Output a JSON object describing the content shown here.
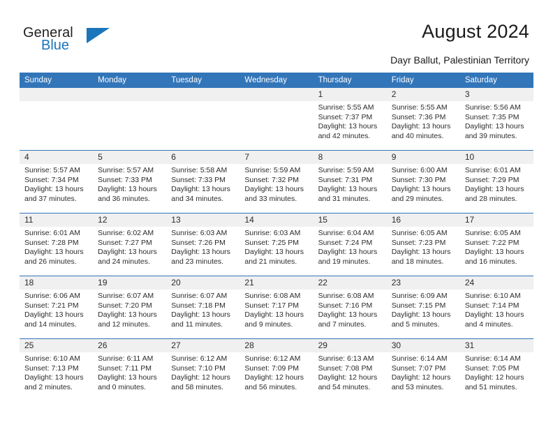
{
  "logo": {
    "text_dark": "General",
    "text_blue": "Blue",
    "accent_color": "#1b75bb",
    "triangle_icon": "logo-triangle-icon"
  },
  "header": {
    "title": "August 2024",
    "subtitle": "Dayr Ballut, Palestinian Territory"
  },
  "calendar": {
    "header_bg": "#3275b9",
    "daynum_bg": "#f0f0f0",
    "weekday_headers": [
      "Sunday",
      "Monday",
      "Tuesday",
      "Wednesday",
      "Thursday",
      "Friday",
      "Saturday"
    ],
    "weeks": [
      [
        {
          "day": "",
          "empty": true
        },
        {
          "day": "",
          "empty": true
        },
        {
          "day": "",
          "empty": true
        },
        {
          "day": "",
          "empty": true
        },
        {
          "day": "1",
          "sunrise": "Sunrise: 5:55 AM",
          "sunset": "Sunset: 7:37 PM",
          "daylight_line1": "Daylight: 13 hours",
          "daylight_line2": "and 42 minutes."
        },
        {
          "day": "2",
          "sunrise": "Sunrise: 5:55 AM",
          "sunset": "Sunset: 7:36 PM",
          "daylight_line1": "Daylight: 13 hours",
          "daylight_line2": "and 40 minutes."
        },
        {
          "day": "3",
          "sunrise": "Sunrise: 5:56 AM",
          "sunset": "Sunset: 7:35 PM",
          "daylight_line1": "Daylight: 13 hours",
          "daylight_line2": "and 39 minutes."
        }
      ],
      [
        {
          "day": "4",
          "sunrise": "Sunrise: 5:57 AM",
          "sunset": "Sunset: 7:34 PM",
          "daylight_line1": "Daylight: 13 hours",
          "daylight_line2": "and 37 minutes."
        },
        {
          "day": "5",
          "sunrise": "Sunrise: 5:57 AM",
          "sunset": "Sunset: 7:33 PM",
          "daylight_line1": "Daylight: 13 hours",
          "daylight_line2": "and 36 minutes."
        },
        {
          "day": "6",
          "sunrise": "Sunrise: 5:58 AM",
          "sunset": "Sunset: 7:33 PM",
          "daylight_line1": "Daylight: 13 hours",
          "daylight_line2": "and 34 minutes."
        },
        {
          "day": "7",
          "sunrise": "Sunrise: 5:59 AM",
          "sunset": "Sunset: 7:32 PM",
          "daylight_line1": "Daylight: 13 hours",
          "daylight_line2": "and 33 minutes."
        },
        {
          "day": "8",
          "sunrise": "Sunrise: 5:59 AM",
          "sunset": "Sunset: 7:31 PM",
          "daylight_line1": "Daylight: 13 hours",
          "daylight_line2": "and 31 minutes."
        },
        {
          "day": "9",
          "sunrise": "Sunrise: 6:00 AM",
          "sunset": "Sunset: 7:30 PM",
          "daylight_line1": "Daylight: 13 hours",
          "daylight_line2": "and 29 minutes."
        },
        {
          "day": "10",
          "sunrise": "Sunrise: 6:01 AM",
          "sunset": "Sunset: 7:29 PM",
          "daylight_line1": "Daylight: 13 hours",
          "daylight_line2": "and 28 minutes."
        }
      ],
      [
        {
          "day": "11",
          "sunrise": "Sunrise: 6:01 AM",
          "sunset": "Sunset: 7:28 PM",
          "daylight_line1": "Daylight: 13 hours",
          "daylight_line2": "and 26 minutes."
        },
        {
          "day": "12",
          "sunrise": "Sunrise: 6:02 AM",
          "sunset": "Sunset: 7:27 PM",
          "daylight_line1": "Daylight: 13 hours",
          "daylight_line2": "and 24 minutes."
        },
        {
          "day": "13",
          "sunrise": "Sunrise: 6:03 AM",
          "sunset": "Sunset: 7:26 PM",
          "daylight_line1": "Daylight: 13 hours",
          "daylight_line2": "and 23 minutes."
        },
        {
          "day": "14",
          "sunrise": "Sunrise: 6:03 AM",
          "sunset": "Sunset: 7:25 PM",
          "daylight_line1": "Daylight: 13 hours",
          "daylight_line2": "and 21 minutes."
        },
        {
          "day": "15",
          "sunrise": "Sunrise: 6:04 AM",
          "sunset": "Sunset: 7:24 PM",
          "daylight_line1": "Daylight: 13 hours",
          "daylight_line2": "and 19 minutes."
        },
        {
          "day": "16",
          "sunrise": "Sunrise: 6:05 AM",
          "sunset": "Sunset: 7:23 PM",
          "daylight_line1": "Daylight: 13 hours",
          "daylight_line2": "and 18 minutes."
        },
        {
          "day": "17",
          "sunrise": "Sunrise: 6:05 AM",
          "sunset": "Sunset: 7:22 PM",
          "daylight_line1": "Daylight: 13 hours",
          "daylight_line2": "and 16 minutes."
        }
      ],
      [
        {
          "day": "18",
          "sunrise": "Sunrise: 6:06 AM",
          "sunset": "Sunset: 7:21 PM",
          "daylight_line1": "Daylight: 13 hours",
          "daylight_line2": "and 14 minutes."
        },
        {
          "day": "19",
          "sunrise": "Sunrise: 6:07 AM",
          "sunset": "Sunset: 7:20 PM",
          "daylight_line1": "Daylight: 13 hours",
          "daylight_line2": "and 12 minutes."
        },
        {
          "day": "20",
          "sunrise": "Sunrise: 6:07 AM",
          "sunset": "Sunset: 7:18 PM",
          "daylight_line1": "Daylight: 13 hours",
          "daylight_line2": "and 11 minutes."
        },
        {
          "day": "21",
          "sunrise": "Sunrise: 6:08 AM",
          "sunset": "Sunset: 7:17 PM",
          "daylight_line1": "Daylight: 13 hours",
          "daylight_line2": "and 9 minutes."
        },
        {
          "day": "22",
          "sunrise": "Sunrise: 6:08 AM",
          "sunset": "Sunset: 7:16 PM",
          "daylight_line1": "Daylight: 13 hours",
          "daylight_line2": "and 7 minutes."
        },
        {
          "day": "23",
          "sunrise": "Sunrise: 6:09 AM",
          "sunset": "Sunset: 7:15 PM",
          "daylight_line1": "Daylight: 13 hours",
          "daylight_line2": "and 5 minutes."
        },
        {
          "day": "24",
          "sunrise": "Sunrise: 6:10 AM",
          "sunset": "Sunset: 7:14 PM",
          "daylight_line1": "Daylight: 13 hours",
          "daylight_line2": "and 4 minutes."
        }
      ],
      [
        {
          "day": "25",
          "sunrise": "Sunrise: 6:10 AM",
          "sunset": "Sunset: 7:13 PM",
          "daylight_line1": "Daylight: 13 hours",
          "daylight_line2": "and 2 minutes."
        },
        {
          "day": "26",
          "sunrise": "Sunrise: 6:11 AM",
          "sunset": "Sunset: 7:11 PM",
          "daylight_line1": "Daylight: 13 hours",
          "daylight_line2": "and 0 minutes."
        },
        {
          "day": "27",
          "sunrise": "Sunrise: 6:12 AM",
          "sunset": "Sunset: 7:10 PM",
          "daylight_line1": "Daylight: 12 hours",
          "daylight_line2": "and 58 minutes."
        },
        {
          "day": "28",
          "sunrise": "Sunrise: 6:12 AM",
          "sunset": "Sunset: 7:09 PM",
          "daylight_line1": "Daylight: 12 hours",
          "daylight_line2": "and 56 minutes."
        },
        {
          "day": "29",
          "sunrise": "Sunrise: 6:13 AM",
          "sunset": "Sunset: 7:08 PM",
          "daylight_line1": "Daylight: 12 hours",
          "daylight_line2": "and 54 minutes."
        },
        {
          "day": "30",
          "sunrise": "Sunrise: 6:14 AM",
          "sunset": "Sunset: 7:07 PM",
          "daylight_line1": "Daylight: 12 hours",
          "daylight_line2": "and 53 minutes."
        },
        {
          "day": "31",
          "sunrise": "Sunrise: 6:14 AM",
          "sunset": "Sunset: 7:05 PM",
          "daylight_line1": "Daylight: 12 hours",
          "daylight_line2": "and 51 minutes."
        }
      ]
    ]
  }
}
